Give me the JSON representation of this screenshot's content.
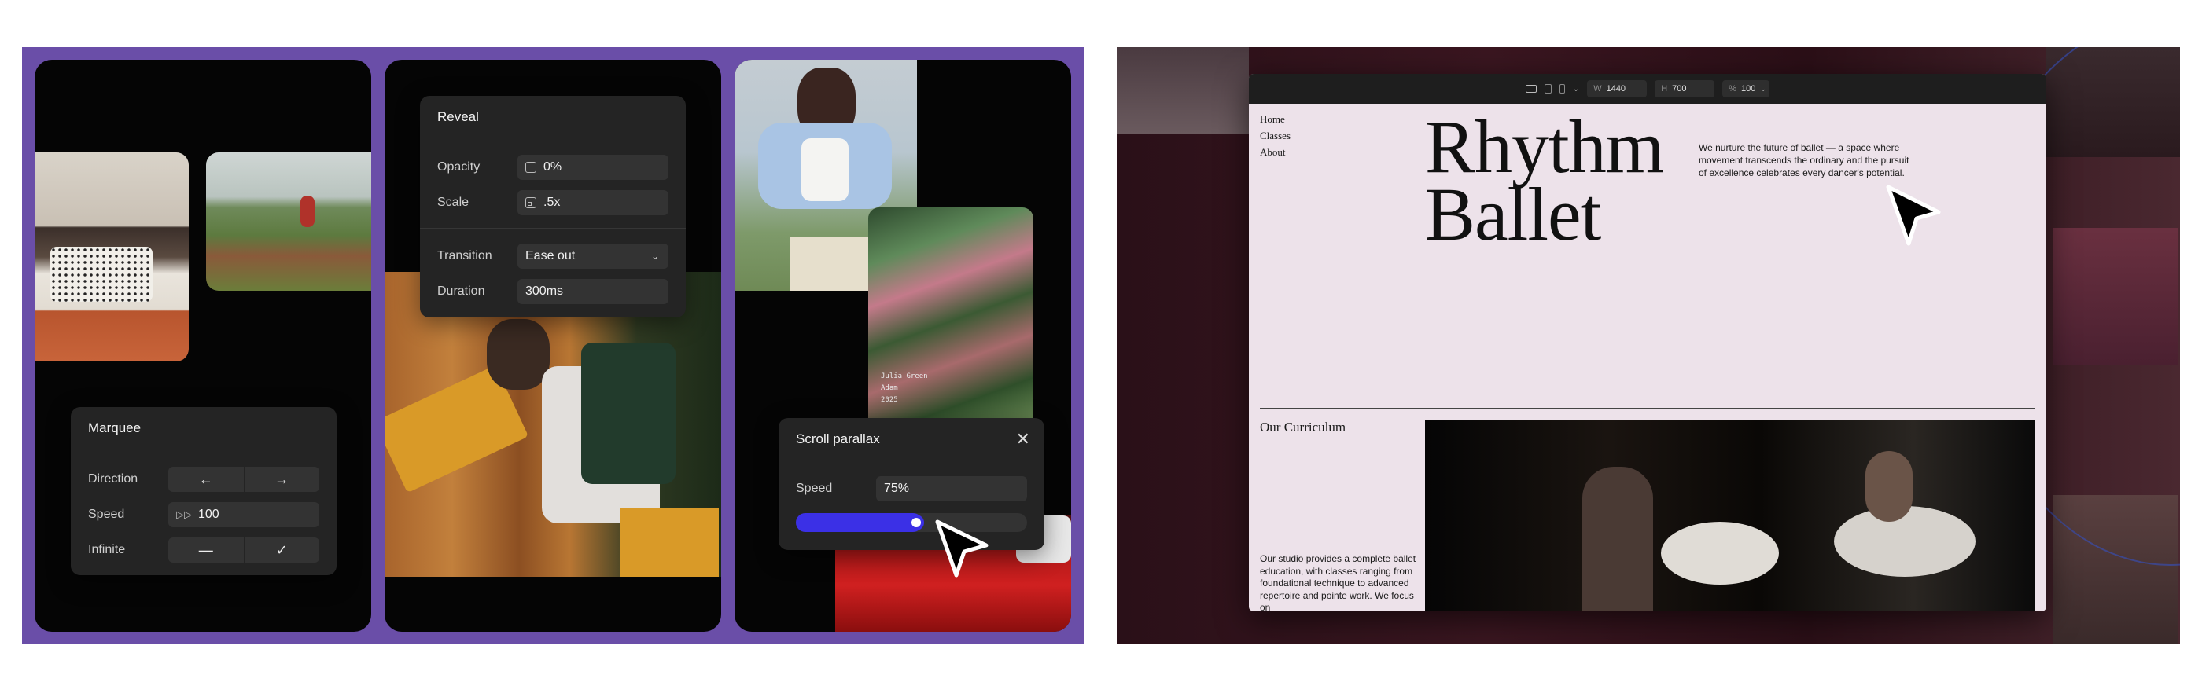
{
  "reveal_panel": {
    "title": "Reveal",
    "opacity_label": "Opacity",
    "opacity_value": "0%",
    "scale_label": "Scale",
    "scale_value": ".5x",
    "transition_label": "Transition",
    "transition_value": "Ease out",
    "duration_label": "Duration",
    "duration_value": "300ms"
  },
  "marquee_panel": {
    "title": "Marquee",
    "direction_label": "Direction",
    "speed_label": "Speed",
    "speed_value": "100",
    "infinite_label": "Infinite"
  },
  "parallax_panel": {
    "title": "Scroll parallax",
    "speed_label": "Speed",
    "speed_value": "75%",
    "slider_fraction": 0.5
  },
  "photo_caption": {
    "line1": "Julia Green",
    "line2": "Adam",
    "line3": "2025"
  },
  "browser_toolbar": {
    "width_label": "W",
    "width_value": "1440",
    "height_label": "H",
    "height_value": "700",
    "zoom_label": "%",
    "zoom_value": "100"
  },
  "site": {
    "nav": [
      "Home",
      "Classes",
      "About"
    ],
    "hero_title_line1": "Rhythm",
    "hero_title_line2": "Ballet",
    "hero_desc": "We nurture the future of ballet — a space where movement transcends the ordinary and the pursuit of excellence celebrates every dancer's potential.",
    "curriculum_title": "Our Curriculum",
    "curriculum_desc": "Our studio provides a complete ballet education, with classes ranging from foundational technique to advanced repertoire and pointe work. We focus on"
  },
  "colors": {
    "frame_purple": "#6a4ea8",
    "slider_blue": "#3b30e6",
    "site_bg": "#ede2ea",
    "panel_bg": "#242424"
  }
}
